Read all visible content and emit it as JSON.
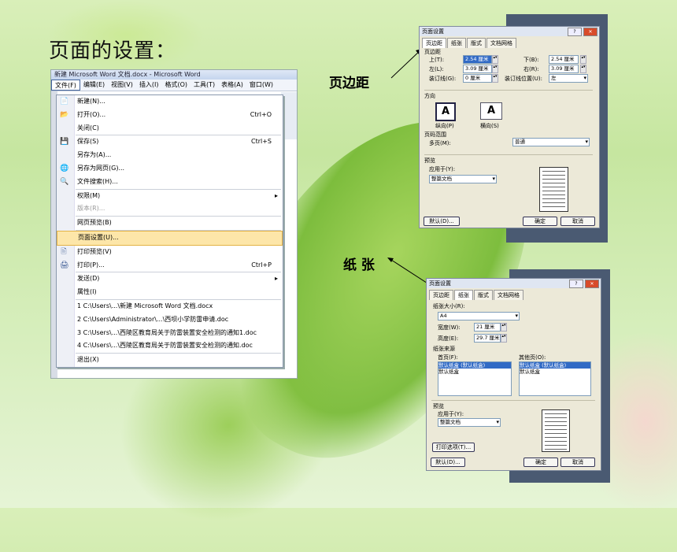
{
  "slide_title": "页面的设置：",
  "callouts": {
    "margins": "页边距",
    "paper": "纸 张"
  },
  "word": {
    "title": "新建 Microsoft Word 文档.docx - Microsoft Word",
    "menubar": [
      "文件(F)",
      "编辑(E)",
      "视图(V)",
      "插入(I)",
      "格式(O)",
      "工具(T)",
      "表格(A)",
      "窗口(W)"
    ],
    "menu": [
      {
        "label": "新建(N)...",
        "icon": "📄"
      },
      {
        "label": "打开(O)...",
        "shortcut": "Ctrl+O",
        "icon": "📂"
      },
      {
        "label": "关闭(C)"
      },
      {
        "sep": true
      },
      {
        "label": "保存(S)",
        "shortcut": "Ctrl+S",
        "icon": "💾"
      },
      {
        "label": "另存为(A)..."
      },
      {
        "label": "另存为网页(G)...",
        "icon": "🌐"
      },
      {
        "label": "文件搜索(H)...",
        "icon": "🔍"
      },
      {
        "sep": true
      },
      {
        "label": "权限(M)",
        "arrow": "▸"
      },
      {
        "label": "版本(R)...",
        "disabled": true
      },
      {
        "sep": true
      },
      {
        "label": "网页预览(B)"
      },
      {
        "sep": true
      },
      {
        "label": "页面设置(U)...",
        "highlight": true
      },
      {
        "label": "打印预览(V)",
        "icon": "🖹"
      },
      {
        "label": "打印(P)...",
        "shortcut": "Ctrl+P",
        "icon": "🖨"
      },
      {
        "sep": true
      },
      {
        "label": "发送(D)",
        "arrow": "▸"
      },
      {
        "label": "属性(I)"
      },
      {
        "sep": true
      },
      {
        "label": "1 C:\\Users\\...\\新建 Microsoft Word 文档.docx"
      },
      {
        "label": "2 C:\\Users\\Administrator\\...\\西坝小学防雷申请.doc"
      },
      {
        "label": "3 C:\\Users\\...\\西陵区教育局关于防雷装置安全检测的通知1.doc"
      },
      {
        "label": "4 C:\\Users\\...\\西陵区教育局关于防雷装置安全检测的通知.doc"
      },
      {
        "sep": true
      },
      {
        "label": "退出(X)"
      }
    ]
  },
  "dialog1": {
    "title": "页面设置",
    "tabs": [
      "页边距",
      "纸张",
      "版式",
      "文档网格"
    ],
    "section_margins": "页边距",
    "top_label": "上(T):",
    "top_value": "2.54 厘米",
    "bottom_label": "下(B):",
    "bottom_value": "2.54 厘米",
    "left_label": "左(L):",
    "left_value": "3.09 厘米",
    "right_label": "右(R):",
    "right_value": "3.09 厘米",
    "gutter_label": "装订线(G):",
    "gutter_value": "0 厘米",
    "gutterpos_label": "装订线位置(U):",
    "gutterpos_value": "左",
    "section_orientation": "方向",
    "portrait": "纵向(P)",
    "landscape": "横向(S)",
    "section_pages": "页码范围",
    "multipage_label": "多页(M):",
    "multipage_value": "普通",
    "section_preview": "预览",
    "apply_label": "应用于(Y):",
    "apply_value": "整篇文档",
    "default_btn": "默认(D)...",
    "ok_btn": "确定",
    "cancel_btn": "取消"
  },
  "dialog2": {
    "title": "页面设置",
    "tabs": [
      "页边距",
      "纸张",
      "版式",
      "文档网格"
    ],
    "paper_size_label": "纸张大小(R):",
    "paper_size_value": "A4",
    "width_label": "宽度(W):",
    "width_value": "21 厘米",
    "height_label": "高度(E):",
    "height_value": "29.7 厘米",
    "source_label": "纸张来源",
    "first_page_label": "首页(F):",
    "other_pages_label": "其他页(O):",
    "first_list": [
      "默认纸盒 (默认纸盒)",
      "默认纸盒"
    ],
    "other_list": [
      "默认纸盒 (默认纸盒)",
      "默认纸盒"
    ],
    "section_preview": "预览",
    "apply_label": "应用于(Y):",
    "apply_value": "整篇文档",
    "print_options_btn": "打印选项(T)...",
    "default_btn": "默认(D)...",
    "ok_btn": "确定",
    "cancel_btn": "取消"
  }
}
